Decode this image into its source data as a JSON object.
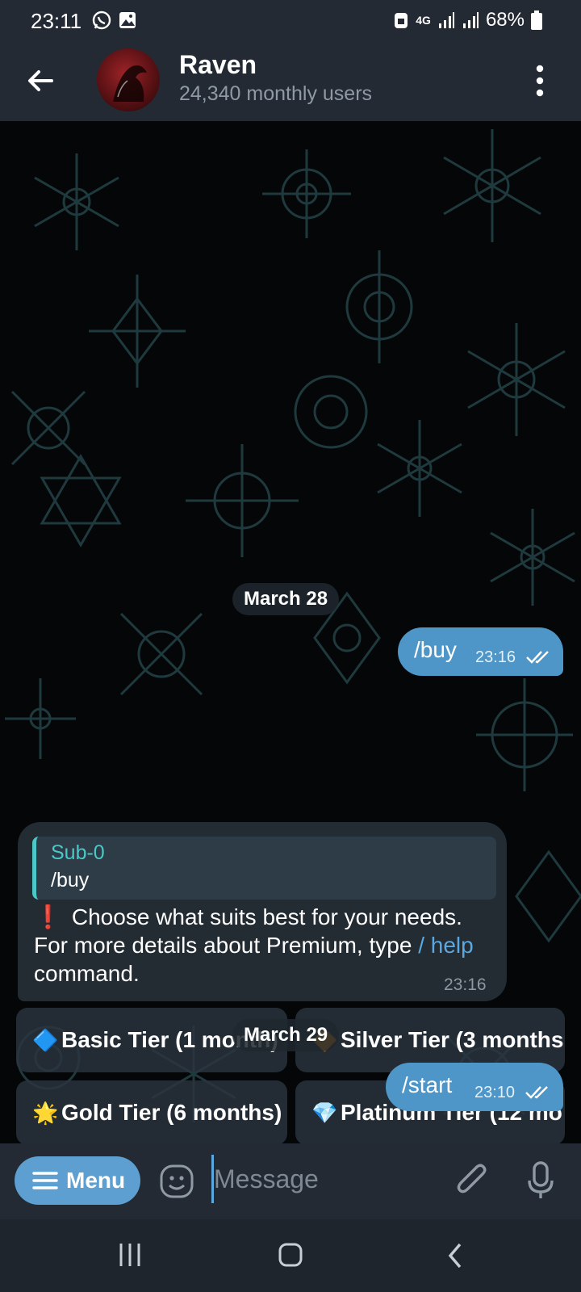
{
  "status_bar": {
    "time": "23:11",
    "network": "4G",
    "battery": "68%"
  },
  "header": {
    "title": "Raven",
    "subtitle": "24,340 monthly users"
  },
  "chat": {
    "date_1": "March 28",
    "outgoing_1": {
      "text": "/buy",
      "time": "23:16"
    },
    "incoming": {
      "reply_from": "Sub-0",
      "reply_text": "/buy",
      "emoji": "❗",
      "text_1": "Choose what suits best for your needs. For more details about Premium, type",
      "link": "/ help",
      "text_2": "command.",
      "time": "23:16"
    },
    "keyboard": [
      {
        "emoji": "🔷",
        "label": "Basic Tier (1 month)"
      },
      {
        "emoji": "🔶",
        "label": "Silver Tier (3 months"
      },
      {
        "emoji": "🌟",
        "label": "Gold Tier (6 months)"
      },
      {
        "emoji": "💎",
        "label": "Platinum Tier (12 mo"
      }
    ],
    "date_2": "March 29",
    "outgoing_2": {
      "text": "/start",
      "time": "23:10"
    }
  },
  "composer": {
    "menu_label": "Menu",
    "placeholder": "Message"
  },
  "colors": {
    "accent": "#4e96c8",
    "header_bg": "#232a33",
    "incoming_bg": "#232b33",
    "reply_accent": "#4bc8c7",
    "link": "#5ba8e0"
  }
}
